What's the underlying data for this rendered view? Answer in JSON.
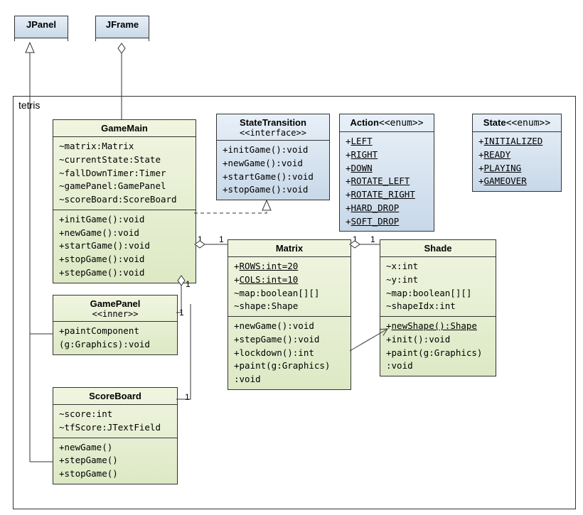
{
  "package": "tetris",
  "jpanel": "JPanel",
  "jframe": "JFrame",
  "gamemain": {
    "name": "GameMain",
    "attrs": [
      "~matrix:Matrix",
      "~currentState:State",
      "~fallDownTimer:Timer",
      "~gamePanel:GamePanel",
      "~scoreBoard:ScoreBoard"
    ],
    "ops": [
      "+initGame():void",
      "+newGame():void",
      "+startGame():void",
      "+stopGame():void",
      "+stepGame():void"
    ]
  },
  "statetransition": {
    "name": "StateTransition",
    "stereo": "<<interface>>",
    "ops": [
      "+initGame():void",
      "+newGame():void",
      "+startGame():void",
      "+stopGame():void"
    ]
  },
  "action": {
    "name": "Action",
    "stereo": "<<enum>>",
    "vals": [
      "LEFT",
      "RIGHT",
      "DOWN",
      "ROTATE_LEFT",
      "ROTATE_RIGHT",
      "HARD_DROP",
      "SOFT_DROP"
    ]
  },
  "state": {
    "name": "State",
    "stereo": "<<enum>>",
    "vals": [
      "INITIALIZED",
      "READY",
      "PLAYING",
      "GAMEOVER"
    ]
  },
  "gamepanel": {
    "name": "GamePanel",
    "stereo": "<<inner>>",
    "ops": [
      "+paintComponent",
      "  (g:Graphics):void"
    ]
  },
  "scoreboard": {
    "name": "ScoreBoard",
    "attrs": [
      "~score:int",
      "~tfScore:JTextField"
    ],
    "ops": [
      "+newGame()",
      "+stepGame()",
      "+stopGame()"
    ]
  },
  "matrix": {
    "name": "Matrix",
    "attrs_u": [
      "ROWS:int=20",
      "COLS:int=10"
    ],
    "attrs": [
      "~map:boolean[][]",
      "~shape:Shape"
    ],
    "ops": [
      "+newGame():void",
      "+stepGame():void",
      "+lockdown():int",
      "+paint(g:Graphics)",
      "  :void"
    ]
  },
  "shade": {
    "name": "Shade",
    "attrs": [
      "~x:int",
      "~y:int",
      "~map:boolean[][]",
      "~shapeIdx:int"
    ],
    "ops_u": "newShape():Shape",
    "ops": [
      "+init():void",
      "+paint(g:Graphics)",
      "  :void"
    ]
  }
}
